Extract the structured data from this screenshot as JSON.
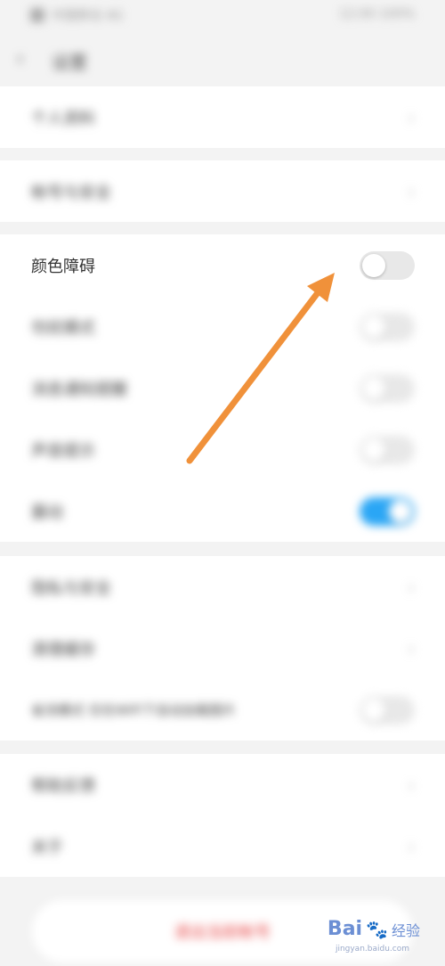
{
  "statusbar": {
    "left_text": "中国移动 4G",
    "right_text": "12:00 100%"
  },
  "header": {
    "back_icon": "back-arrow-icon",
    "title": "设置"
  },
  "group1": [
    {
      "label": "个人资料"
    }
  ],
  "group2": [
    {
      "label": "帐号与安全"
    }
  ],
  "group3": [
    {
      "label": "颜色障碍",
      "toggle": false
    },
    {
      "label": "勿扰模式",
      "toggle": false
    },
    {
      "label": "消息通知提醒",
      "toggle": false
    },
    {
      "label": "声音提示",
      "toggle": false
    },
    {
      "label": "震动",
      "toggle": true
    }
  ],
  "group4": [
    {
      "label": "隐私与安全"
    },
    {
      "label": "清理缓存"
    },
    {
      "label": "省流模式 仅在WiFi下自动加载图片",
      "toggle": false
    }
  ],
  "group5": [
    {
      "label": "帮助反馈"
    },
    {
      "label": "关于"
    }
  ],
  "logout": {
    "label": "退出当前帐号"
  },
  "watermark": {
    "brand": "Bai",
    "suffix": "经验",
    "url": "jingyan.baidu.com"
  },
  "colors": {
    "toggle_on": "#2aa6f5",
    "arrow": "#f0913a",
    "logout": "#e84a4a"
  }
}
